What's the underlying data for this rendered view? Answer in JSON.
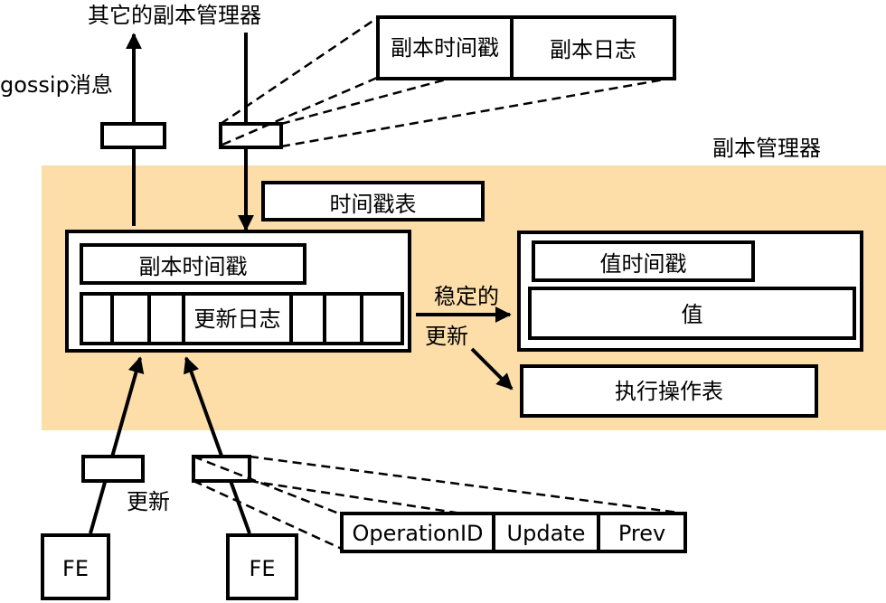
{
  "colors": {
    "region_fill": "#FDDEA9",
    "stroke": "#000000",
    "box_fill": "#FFFFFF"
  },
  "labels": {
    "other_managers": "其它的副本管理器",
    "gossip": "gossip消息",
    "replica_manager": "副本管理器",
    "timestamp_table": "时间戳表",
    "stable_updates_1": "稳定的",
    "stable_updates_2": "更新",
    "update": "更新"
  },
  "replica_block": {
    "timestamp": "副本时间戳",
    "update_log": "更新日志"
  },
  "gossip_detail": {
    "timestamp": "副本时间戳",
    "log": "副本日志"
  },
  "value_block": {
    "timestamp": "值时间戳",
    "value": "值"
  },
  "executed_ops": "执行操作表",
  "update_detail": {
    "fields": [
      "OperationID",
      "Update",
      "Prev"
    ]
  },
  "front_ends": [
    "FE",
    "FE"
  ]
}
